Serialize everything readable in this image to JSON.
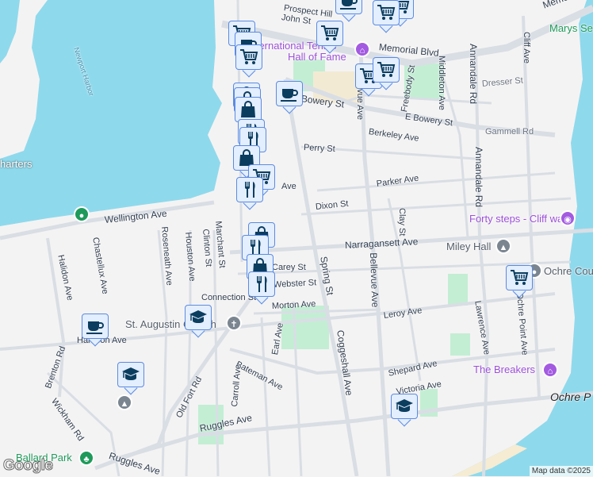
{
  "map": {
    "colors": {
      "water": "#8fd9ec",
      "land": "#f4f3f3",
      "road": "#d9dee5",
      "park": "#c3eed4",
      "marker_fill": "#e3eeff",
      "marker_border": "#5b8be0",
      "marker_icon": "#0b3d5e"
    },
    "water_labels": {
      "harbor": "Newport Harbor"
    },
    "pois": {
      "hall_of_fame_line1": "International Tennis",
      "hall_of_fame_line2": "Hall of Fame",
      "marys": "Marys Se",
      "forty_steps": "Forty steps - Cliff walk",
      "miley_hall": "Miley Hall",
      "ochre_court": "Ochre Cou",
      "breakers": "The Breakers",
      "ochre_point": "Ochre P",
      "st_augustin": "St. Augustin Church",
      "ballard_park": "Ballard Park",
      "charters": "harters"
    },
    "streets": {
      "prospect_hill": "Prospect Hill",
      "john": "John St",
      "memorial": "Memorial Blvd",
      "memorial2": "Memo",
      "cliff": "Cliff Ave",
      "annandale1": "Annandale Rd",
      "annandale2": "Annandale Rd",
      "middleton": "Middleton Ave",
      "freebody": "Freebody St",
      "dresser": "Dresser St",
      "bowery": "Bowery St",
      "e_bowery": "E Bowery St",
      "bellevue": "Bellevue Ave",
      "bellevue_top": "vue Ave",
      "berkeley": "Berkeley Ave",
      "gammell": "Gammell Rd",
      "perry": "Perry St",
      "parker": "Parker Ave",
      "dixon": "Dixon St",
      "clay": "Clay St",
      "wellington": "Wellington Ave",
      "ave_frag": "Ave",
      "narragansett": "Narragansett Ave",
      "spring": "Spring St",
      "chastellux": "Chastellux Ave",
      "roseneath": "Roseneath Ave",
      "houston": "Houston Ave",
      "clinton": "Clinton St",
      "marchant": "Marchant St",
      "halidon": "Halidon Ave",
      "carey": "Carey St",
      "webster": "Webster St",
      "connection": "Connection St",
      "morton": "Morton Ave",
      "leroy": "Leroy Ave",
      "lawrence": "Lawrence Ave",
      "ochre_point_ave": "Ochre Point Ave",
      "earl": "Earl Ave",
      "harrison": "Harrison Ave",
      "coggeshall": "Coggeshall Ave",
      "brenton": "Brenton Rd",
      "bateman": "Bateman Ave",
      "shepard": "Shepard Ave",
      "victoria": "Victoria Ave",
      "old_fort": "Old Fort Rd",
      "carroll": "Carroll Ave",
      "wickham": "Wickham Rd",
      "ruggles1": "Ruggles Ave",
      "ruggles2": "Ruggles Ave"
    },
    "markers": [
      "coffee",
      "cart",
      "cart",
      "cart",
      "cart",
      "coffee",
      "cart",
      "coffee",
      "cart",
      "cart",
      "bag",
      "bag",
      "bag",
      "fork",
      "fork",
      "bag",
      "cart",
      "fork",
      "bag",
      "fork",
      "bag",
      "fork",
      "cart",
      "grad",
      "coffee",
      "grad",
      "grad"
    ],
    "logo": "Google",
    "attribution": "Map data ©2025"
  }
}
